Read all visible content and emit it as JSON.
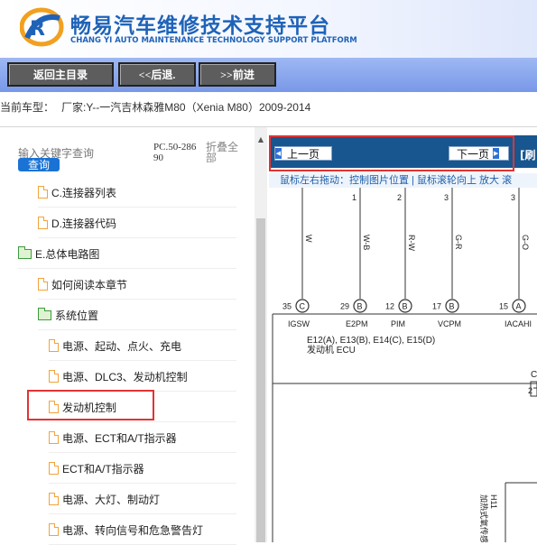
{
  "header": {
    "title_cn": "畅易汽车维修技术支持平台",
    "title_en": "CHANG YI AUTO MAINTENANCE TECHNOLOGY SUPPORT PLATFORM",
    "logo_icon": "cy-logo-icon"
  },
  "nav": {
    "home": "返回主目录",
    "back": "<<后退.",
    "forward": ">>前进"
  },
  "car": {
    "label": "当前车型：",
    "maker": "厂家:Y--一汽吉林森雅M80（Xenia M80）2009-2014"
  },
  "sidebar": {
    "search_placeholder": "输入关键字查询",
    "search_button": "查询",
    "pc_code": "PC.50-28690",
    "collapse_all": "折叠全部",
    "items": [
      {
        "label": "C.连接器列表",
        "icon": "file-icon"
      },
      {
        "label": "D.连接器代码",
        "icon": "file-icon"
      },
      {
        "label": "E.总体电路图",
        "icon": "folder-open-icon"
      },
      {
        "label": "如何阅读本章节",
        "icon": "file-icon"
      },
      {
        "label": "系统位置",
        "icon": "folder-open-icon"
      },
      {
        "label": "电源、起动、点火、充电",
        "icon": "file-icon"
      },
      {
        "label": "电源、DLC3、发动机控制",
        "icon": "file-icon"
      },
      {
        "label": "发动机控制",
        "icon": "file-icon"
      },
      {
        "label": "电源、ECT和A/T指示器",
        "icon": "file-icon"
      },
      {
        "label": "ECT和A/T指示器",
        "icon": "file-icon"
      },
      {
        "label": "电源、大灯、制动灯",
        "icon": "file-icon"
      },
      {
        "label": "电源、转向信号和危急警告灯",
        "icon": "file-icon"
      }
    ]
  },
  "pager": {
    "prev": "上一页",
    "next": "下一页",
    "refresh": "[刷",
    "hint": "鼠标左右拖动：控制图片位置 | 鼠标滚轮向上 放大  滚"
  },
  "diagram": {
    "wires": [
      {
        "num": "",
        "color": "W",
        "pin": "35",
        "letter": "C",
        "signal": "IGSW"
      },
      {
        "num": "1",
        "color": "W-B",
        "pin": "29",
        "letter": "B",
        "signal": "E2PM"
      },
      {
        "num": "2",
        "color": "R-W",
        "pin": "12",
        "letter": "B",
        "signal": "PIM"
      },
      {
        "num": "3",
        "color": "G-R",
        "pin": "17",
        "letter": "B",
        "signal": "VCPM"
      },
      {
        "num": "3",
        "color": "G-O",
        "pin": "15",
        "letter": "A",
        "signal": "IACAHI"
      }
    ],
    "ecu_connectors": "E12(A), E13(B), E14(C), E15(D)",
    "ecu_name": "发动机 ECU",
    "right_label_c": "C",
    "right_num": "2",
    "component_code": "H11",
    "component_name": "加热式氧传感器"
  }
}
